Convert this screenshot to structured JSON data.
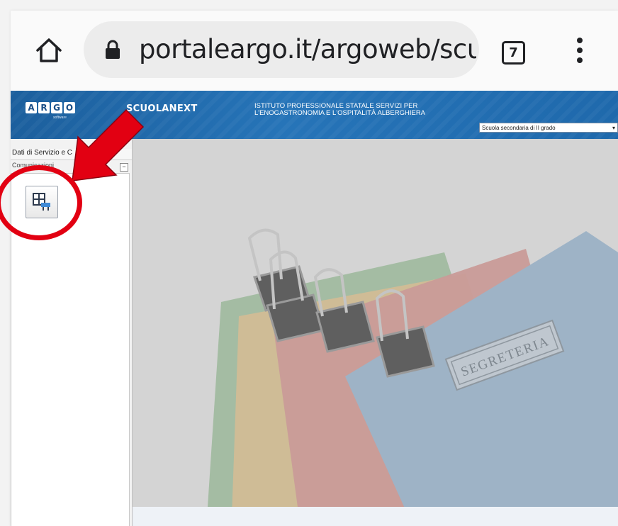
{
  "browser": {
    "url": "portaleargo.it/argoweb/scuo",
    "tab_count": "7"
  },
  "app": {
    "logo_letters": [
      "A",
      "R",
      "G",
      "O"
    ],
    "logo_sub": "software",
    "product": "SCUOLANEXT",
    "school_line1": "ISTITUTO PROFESSIONALE STATALE SERVIZI PER",
    "school_line2": "L'ENOGASTRONOMIA E L'OSPITALITÀ ALBERGHIERA",
    "school_type": "Scuola secondaria di II grado"
  },
  "left_panel": {
    "header": "Dati di Servizio e C",
    "subheader": "Comunicazioni",
    "collapse": "−"
  },
  "main": {
    "folder_stamp": "SEGRETERIA"
  },
  "annotation": {
    "color": "#e20012"
  }
}
